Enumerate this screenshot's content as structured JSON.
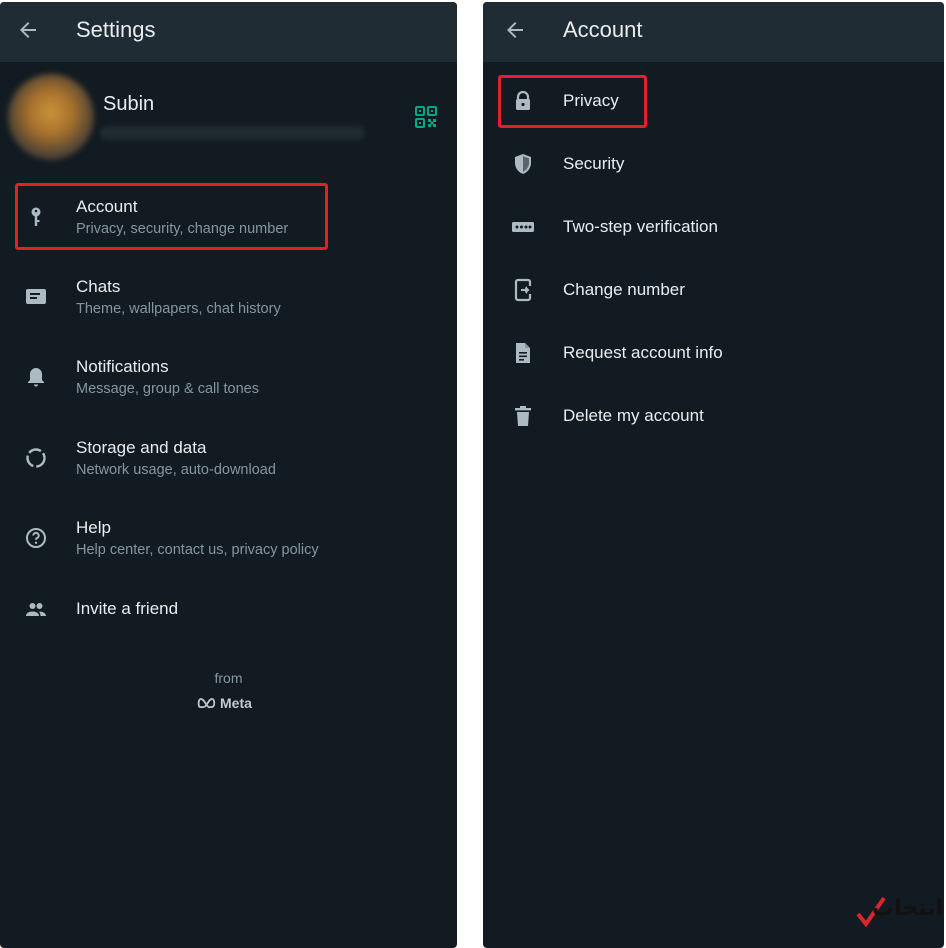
{
  "settings": {
    "title": "Settings",
    "profile": {
      "name": "Subin"
    },
    "items": [
      {
        "label": "Account",
        "subtitle": "Privacy, security, change number",
        "icon": "key-icon"
      },
      {
        "label": "Chats",
        "subtitle": "Theme, wallpapers, chat history",
        "icon": "chat-icon"
      },
      {
        "label": "Notifications",
        "subtitle": "Message, group & call tones",
        "icon": "bell-icon"
      },
      {
        "label": "Storage and data",
        "subtitle": "Network usage, auto-download",
        "icon": "storage-icon"
      },
      {
        "label": "Help",
        "subtitle": "Help center, contact us, privacy policy",
        "icon": "help-icon"
      },
      {
        "label": "Invite a friend",
        "icon": "people-icon"
      }
    ],
    "footer": {
      "from": "from",
      "brand": "Meta"
    }
  },
  "account": {
    "title": "Account",
    "items": [
      {
        "label": "Privacy",
        "icon": "lock-icon"
      },
      {
        "label": "Security",
        "icon": "shield-icon"
      },
      {
        "label": "Two-step verification",
        "icon": "dots-icon"
      },
      {
        "label": "Change number",
        "icon": "phone-transfer-icon"
      },
      {
        "label": "Request account info",
        "icon": "document-icon"
      },
      {
        "label": "Delete my account",
        "icon": "trash-icon"
      }
    ]
  },
  "watermark": {
    "text": "انتخاب"
  },
  "colors": {
    "background": "#121b22",
    "header": "#1f2c34",
    "text": "#e9edef",
    "subtext": "#8696a0",
    "icon": "#aebac1",
    "accent": "#00a884",
    "highlight": "#e0202f"
  }
}
